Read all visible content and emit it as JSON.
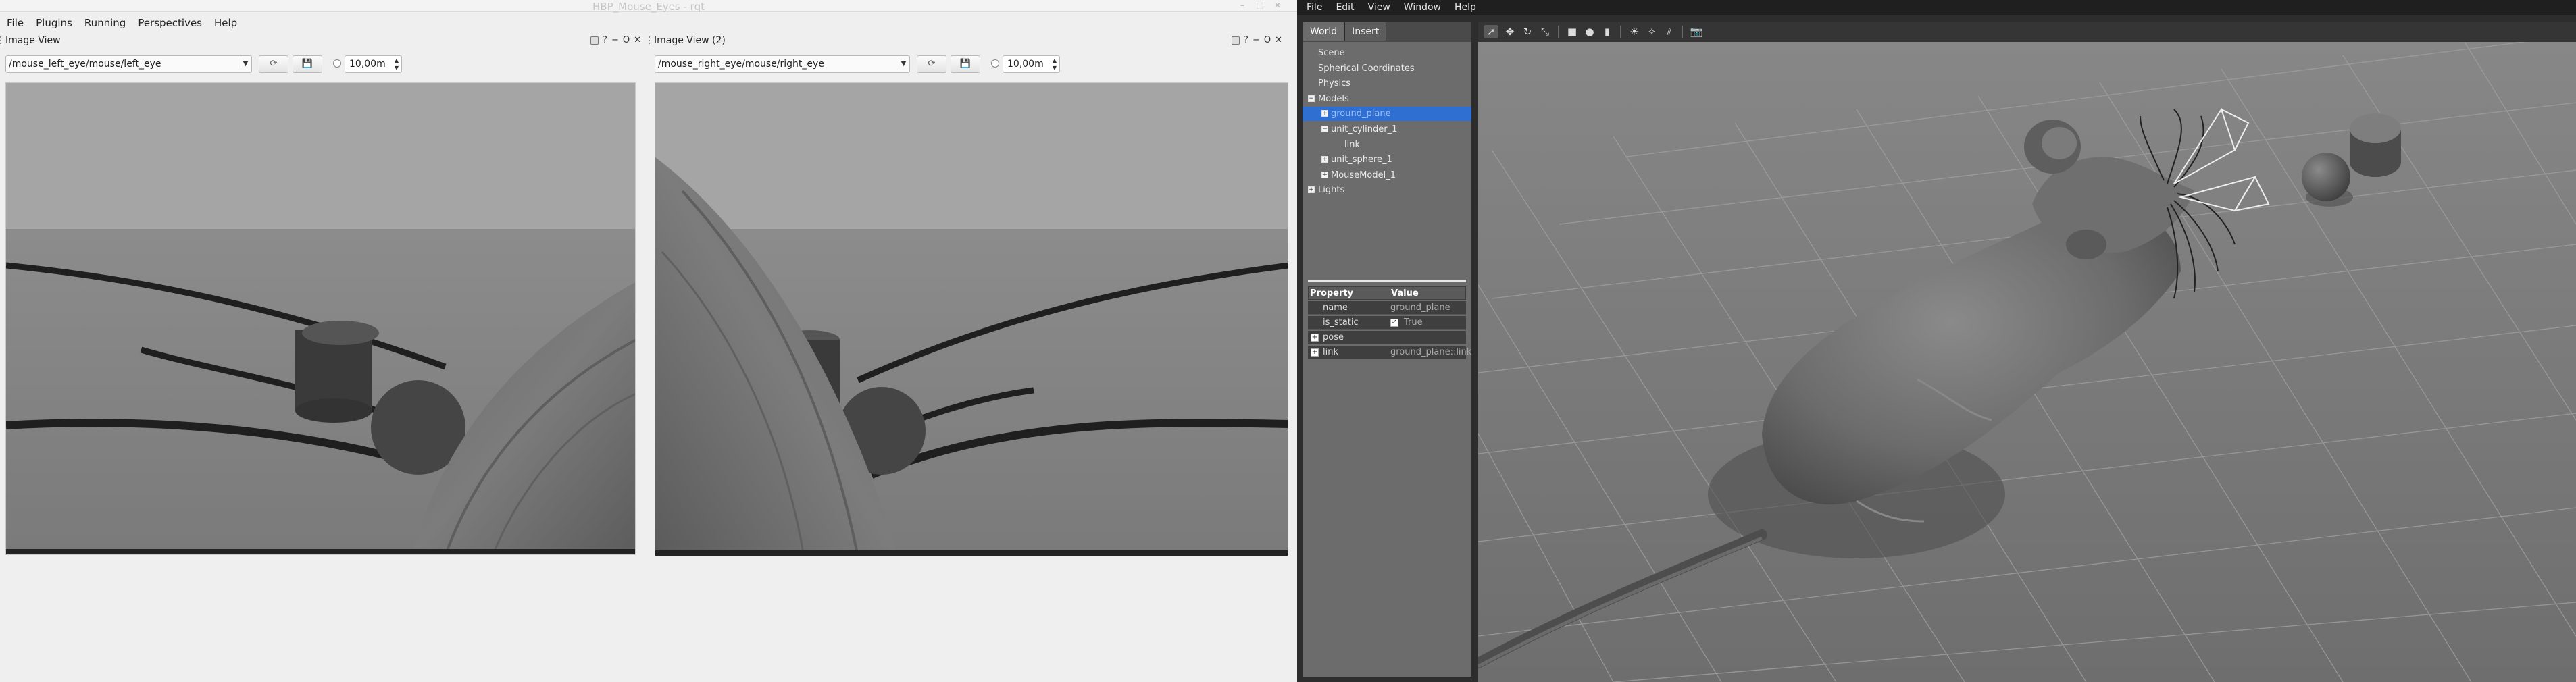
{
  "rqt": {
    "window_title": "HBP_Mouse_Eyes - rqt",
    "menu": [
      "File",
      "Plugins",
      "Running",
      "Perspectives",
      "Help"
    ],
    "panels": [
      {
        "title": "Image View",
        "topic": "/mouse_left_eye/mouse/left_eye",
        "zoom_value": "10,00m"
      },
      {
        "title": "Image View (2)",
        "topic": "/mouse_right_eye/mouse/right_eye",
        "zoom_value": "10,00m"
      }
    ],
    "dock_controls": [
      "D",
      "O",
      "✕"
    ]
  },
  "gazebo": {
    "menu": [
      "File",
      "Edit",
      "View",
      "Window",
      "Help"
    ],
    "tabs": [
      "World",
      "Insert"
    ],
    "active_tab": "World",
    "tree": [
      {
        "label": "Scene",
        "level": 0,
        "expander": ""
      },
      {
        "label": "Spherical Coordinates",
        "level": 0,
        "expander": ""
      },
      {
        "label": "Physics",
        "level": 0,
        "expander": ""
      },
      {
        "label": "Models",
        "level": 0,
        "expander": "−"
      },
      {
        "label": "ground_plane",
        "level": 1,
        "expander": "+",
        "selected": true
      },
      {
        "label": "unit_cylinder_1",
        "level": 1,
        "expander": "−"
      },
      {
        "label": "link",
        "level": 2,
        "expander": ""
      },
      {
        "label": "unit_sphere_1",
        "level": 1,
        "expander": "+"
      },
      {
        "label": "MouseModel_1",
        "level": 1,
        "expander": "+"
      },
      {
        "label": "Lights",
        "level": 0,
        "expander": "+"
      }
    ],
    "properties": {
      "header_property": "Property",
      "header_value": "Value",
      "rows": [
        {
          "key": "name",
          "value": "ground_plane",
          "expander": ""
        },
        {
          "key": "is_static",
          "value": "True",
          "expander": "",
          "checkbox": true
        },
        {
          "key": "pose",
          "value": "",
          "expander": "+"
        },
        {
          "key": "link",
          "value": "ground_plane::link",
          "expander": "+"
        }
      ]
    },
    "toolbar_icons": [
      "select-arrow-icon",
      "translate-icon",
      "rotate-icon",
      "scale-icon",
      "box-icon",
      "sphere-icon",
      "cylinder-icon",
      "point-light-icon",
      "spot-light-icon",
      "directional-light-icon",
      "camera-screenshot-icon"
    ]
  }
}
